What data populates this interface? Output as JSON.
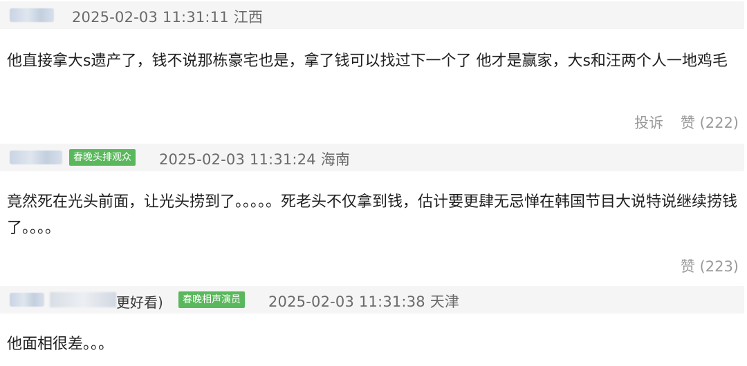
{
  "comments": [
    {
      "time": "2025-02-03 11:31:11",
      "location": "江西",
      "content": "他直接拿大s遗产了，钱不说那栋豪宅也是，拿了钱可以找过下一个了 他才是赢家，大s和汪两个人一地鸡毛",
      "report_label": "投诉",
      "like_label": "赞",
      "like_count": "(222)"
    },
    {
      "badge": "春晚头排观众",
      "time": "2025-02-03 11:31:24",
      "location": "海南",
      "content": "竟然死在光头前面，让光头捞到了。。。。。死老头不仅拿到钱，估计要更肆无忌惮在韩国节目大说特说继续捞钱了。。。。",
      "like_label": "赞",
      "like_count": "(223)"
    },
    {
      "username_suffix": "更好看)",
      "badge": "春晚相声演员",
      "time": "2025-02-03 11:31:38",
      "location": "天津",
      "content": "他面相很差。。。"
    }
  ]
}
